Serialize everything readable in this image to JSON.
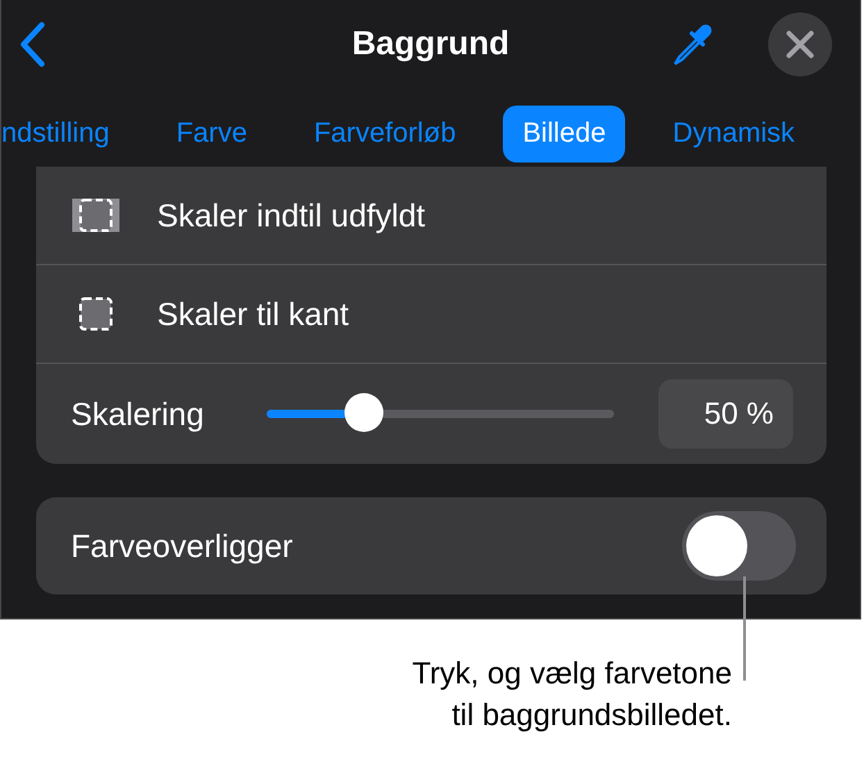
{
  "header": {
    "title": "Baggrund"
  },
  "tabs": [
    {
      "label": "ndstilling",
      "selected": false
    },
    {
      "label": "Farve",
      "selected": false
    },
    {
      "label": "Farveforløb",
      "selected": false
    },
    {
      "label": "Billede",
      "selected": true
    },
    {
      "label": "Dynamisk",
      "selected": false
    }
  ],
  "options": [
    {
      "label": "Skaler indtil udfyldt",
      "kind": "fill"
    },
    {
      "label": "Skaler til kant",
      "kind": "fit"
    }
  ],
  "scale": {
    "label": "Skalering",
    "level": 0.28,
    "value": "50 %"
  },
  "overlay": {
    "label": "Farveoverligger",
    "on": false
  },
  "callout": {
    "lines": [
      "Tryk, og vælg farvetone",
      "til baggrundsbilledet."
    ]
  }
}
